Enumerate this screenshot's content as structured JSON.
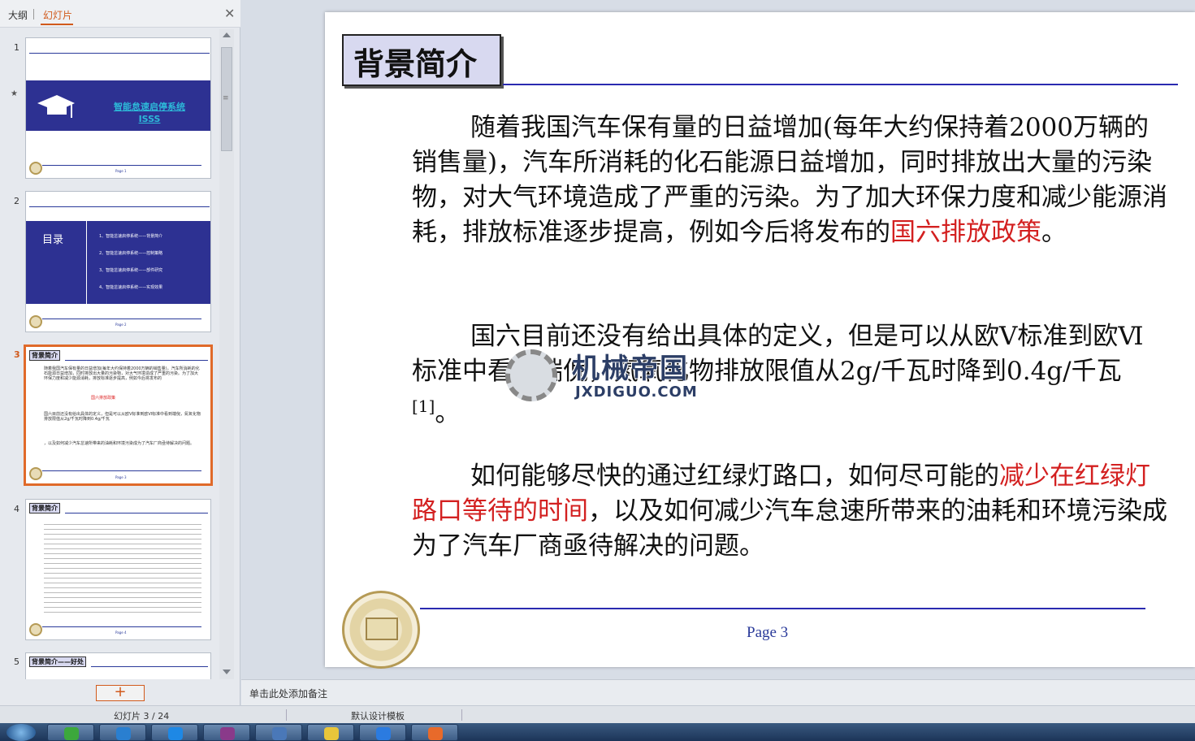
{
  "panel": {
    "tab_outline": "大纲",
    "tab_slides": "幻灯片",
    "close": "✕"
  },
  "thumbnails": [
    {
      "num": "1",
      "title": "智能怠速启停系统",
      "subtitle": "ISSS",
      "page": "Page 1"
    },
    {
      "num": "2",
      "title": "目录",
      "items": [
        "1、智能怠速启停系统——背景简介",
        "2、智能怠速启停系统——控制策略",
        "3、智能怠速启停系统——部件研究",
        "4、智能怠速启停系统——实现效果"
      ],
      "page": "Page 2"
    },
    {
      "num": "3",
      "title": "背景简介",
      "page": "Page 3"
    },
    {
      "num": "4",
      "title": "背景简介",
      "page": "Page 4"
    },
    {
      "num": "5",
      "title": "背景简介——好处"
    }
  ],
  "slide": {
    "title": "背景简介",
    "p1_a": "随着我国汽车保有量的日益增加(每年大约保持着2000万辆的销售量)，汽车所消耗的化石能源日益增加，同时排放出大量的污染物，对大气环境造成了严重的污染。为了加大环保力度和减少能源消耗，排放标准逐步提高，例如今后将发布的",
    "p1_red": "国六排放政策",
    "p1_b": "。",
    "p2": "国六目前还没有给出具体的定义，但是可以从欧Ⅴ标准到欧Ⅵ标准中看到端倪，氮氧化物排放限值从2g/千瓦时降到0.4g/千瓦",
    "p2_sup": "[1]",
    "p2_end": "。",
    "p3_a": "如何能够尽快的通过红绿灯路口，如何尽可能的",
    "p3_red": "减少在红绿灯路口等待的时间",
    "p3_b": "，以及如何减少汽车怠速所带来的油耗和环境污染成为了汽车厂商亟待解决的问题。",
    "page": "Page 3",
    "watermark_cn": "机械帝国",
    "watermark_en": "JXDIGUO.COM"
  },
  "notes": {
    "placeholder": "单击此处添加备注"
  },
  "status": {
    "slide_count": "幻灯片 3 / 24",
    "template": "默认设计模板"
  },
  "add_slide": "+"
}
